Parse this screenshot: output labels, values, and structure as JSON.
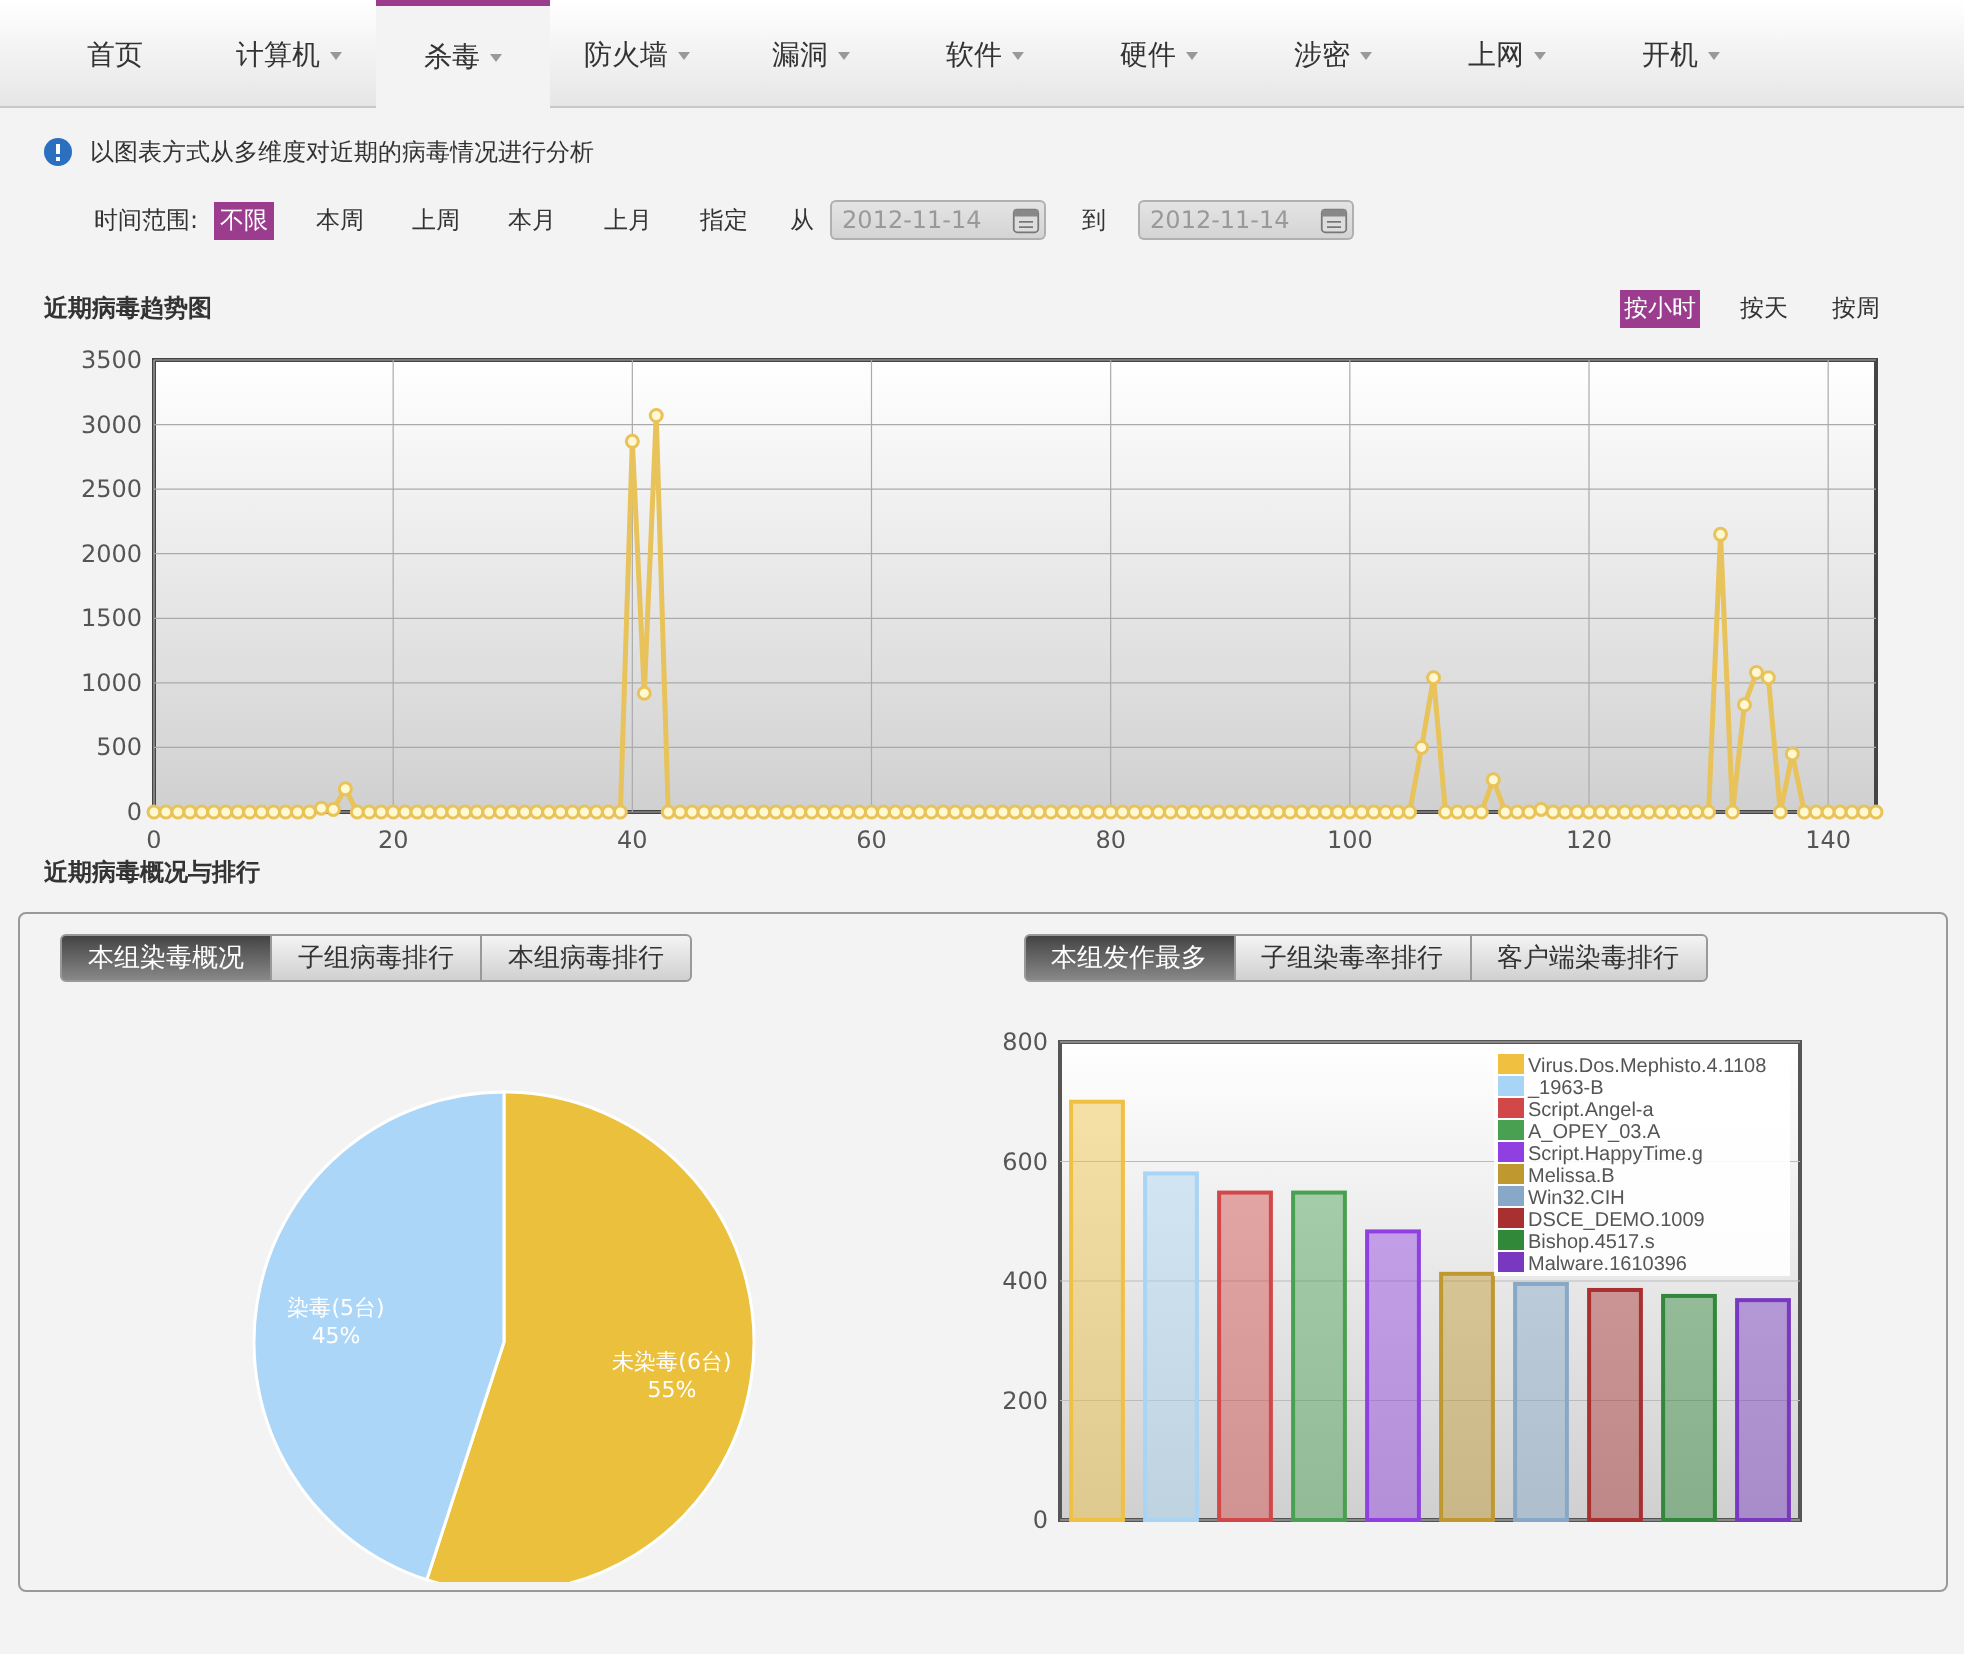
{
  "nav": {
    "tabs": [
      {
        "label": "首页",
        "has_menu": false,
        "selected": false
      },
      {
        "label": "计算机",
        "has_menu": true,
        "selected": false
      },
      {
        "label": "杀毒",
        "has_menu": true,
        "selected": true
      },
      {
        "label": "防火墙",
        "has_menu": true,
        "selected": false
      },
      {
        "label": "漏洞",
        "has_menu": true,
        "selected": false
      },
      {
        "label": "软件",
        "has_menu": true,
        "selected": false
      },
      {
        "label": "硬件",
        "has_menu": true,
        "selected": false
      },
      {
        "label": "涉密",
        "has_menu": true,
        "selected": false
      },
      {
        "label": "上网",
        "has_menu": true,
        "selected": false
      },
      {
        "label": "开机",
        "has_menu": true,
        "selected": false
      }
    ]
  },
  "info": "以图表方式从多维度对近期的病毒情况进行分析",
  "time_filter": {
    "label": "时间范围:",
    "options": [
      {
        "label": "不限",
        "selected": true
      },
      {
        "label": "本周",
        "selected": false
      },
      {
        "label": "上周",
        "selected": false
      },
      {
        "label": "本月",
        "selected": false
      },
      {
        "label": "上月",
        "selected": false
      },
      {
        "label": "指定",
        "selected": false
      }
    ],
    "from_label": "从",
    "from_value": "2012-11-14",
    "to_label": "到",
    "to_value": "2012-11-14"
  },
  "trend": {
    "title": "近期病毒趋势图",
    "modes": [
      {
        "label": "按小时",
        "selected": true
      },
      {
        "label": "按天",
        "selected": false
      },
      {
        "label": "按周",
        "selected": false
      }
    ],
    "chart_data": {
      "type": "line",
      "grid": true,
      "ylim": [
        0,
        3500
      ],
      "yticks": [
        0,
        500,
        1000,
        1500,
        2000,
        2500,
        3000,
        3500
      ],
      "xlim": [
        0,
        144
      ],
      "xticks": [
        0,
        20,
        40,
        60,
        80,
        100,
        120,
        140
      ],
      "x": [
        0,
        1,
        2,
        3,
        4,
        5,
        6,
        7,
        8,
        9,
        10,
        11,
        12,
        13,
        14,
        15,
        16,
        17,
        18,
        19,
        20,
        21,
        22,
        23,
        24,
        25,
        26,
        27,
        28,
        29,
        30,
        31,
        32,
        33,
        34,
        35,
        36,
        37,
        38,
        39,
        40,
        41,
        42,
        43,
        44,
        45,
        46,
        47,
        48,
        49,
        50,
        51,
        52,
        53,
        54,
        55,
        56,
        57,
        58,
        59,
        60,
        61,
        62,
        63,
        64,
        65,
        66,
        67,
        68,
        69,
        70,
        71,
        72,
        73,
        74,
        75,
        76,
        77,
        78,
        79,
        80,
        81,
        82,
        83,
        84,
        85,
        86,
        87,
        88,
        89,
        90,
        91,
        92,
        93,
        94,
        95,
        96,
        97,
        98,
        99,
        100,
        101,
        102,
        103,
        104,
        105,
        106,
        107,
        108,
        109,
        110,
        111,
        112,
        113,
        114,
        115,
        116,
        117,
        118,
        119,
        120,
        121,
        122,
        123,
        124,
        125,
        126,
        127,
        128,
        129,
        130,
        131,
        132,
        133,
        134,
        135,
        136,
        137,
        138,
        139,
        140,
        141,
        142,
        143,
        144
      ],
      "series": [
        {
          "color": "#e8c25a",
          "marker": "circle",
          "values": [
            0,
            0,
            0,
            0,
            0,
            0,
            0,
            0,
            0,
            0,
            0,
            0,
            0,
            0,
            30,
            20,
            180,
            0,
            0,
            0,
            0,
            0,
            0,
            0,
            0,
            0,
            0,
            0,
            0,
            0,
            0,
            0,
            0,
            0,
            0,
            0,
            0,
            0,
            0,
            0,
            2870,
            920,
            3070,
            0,
            0,
            0,
            0,
            0,
            0,
            0,
            0,
            0,
            0,
            0,
            0,
            0,
            0,
            0,
            0,
            0,
            0,
            0,
            0,
            0,
            0,
            0,
            0,
            0,
            0,
            0,
            0,
            0,
            0,
            0,
            0,
            0,
            0,
            0,
            0,
            0,
            0,
            0,
            0,
            0,
            0,
            0,
            0,
            0,
            0,
            0,
            0,
            0,
            0,
            0,
            0,
            0,
            0,
            0,
            0,
            0,
            0,
            0,
            0,
            0,
            0,
            0,
            500,
            1040,
            0,
            0,
            0,
            0,
            250,
            0,
            0,
            0,
            20,
            0,
            0,
            0,
            0,
            0,
            0,
            0,
            0,
            0,
            0,
            0,
            0,
            0,
            0,
            2150,
            0,
            830,
            1080,
            1040,
            0,
            450,
            0,
            0,
            0,
            0,
            0,
            0,
            0
          ]
        }
      ]
    }
  },
  "overview": {
    "title": "近期病毒概况与排行",
    "left": {
      "tabs": [
        {
          "label": "本组染毒概况",
          "selected": true
        },
        {
          "label": "子组病毒排行",
          "selected": false
        },
        {
          "label": "本组病毒排行",
          "selected": false
        }
      ],
      "chart_data": {
        "type": "pie",
        "categories": [
          "未染毒(6台)",
          "染毒(5台)"
        ],
        "values": [
          55,
          45
        ],
        "value_labels": [
          "55%",
          "45%"
        ]
      }
    },
    "right": {
      "tabs": [
        {
          "label": "本组发作最多",
          "selected": true
        },
        {
          "label": "子组染毒率排行",
          "selected": false
        },
        {
          "label": "客户端染毒排行",
          "selected": false
        }
      ],
      "chart_data": {
        "type": "bar",
        "grid": true,
        "legend": true,
        "ylim": [
          0,
          800
        ],
        "yticks": [
          0,
          200,
          400,
          600,
          800
        ],
        "series": [
          {
            "name": "Virus.Dos.Mephisto.4.1108",
            "color": "#f0c040",
            "values": [
              700
            ]
          },
          {
            "name": "_1963-B",
            "color": "#a8d4f5",
            "values": [
              580
            ]
          },
          {
            "name": "Script.Angel-a",
            "color": "#d24848",
            "values": [
              548
            ]
          },
          {
            "name": "A_OPEY_03.A",
            "color": "#48a050",
            "values": [
              548
            ]
          },
          {
            "name": "Script.HappyTime.g",
            "color": "#9040e0",
            "values": [
              483
            ]
          },
          {
            "name": "Melissa.B",
            "color": "#c09830",
            "values": [
              412
            ]
          },
          {
            "name": "Win32.CIH",
            "color": "#88a8c8",
            "values": [
              395
            ]
          },
          {
            "name": "DSCE_DEMO.1009",
            "color": "#a83030",
            "values": [
              385
            ]
          },
          {
            "name": "Bishop.4517.s",
            "color": "#308838",
            "values": [
              375
            ]
          },
          {
            "name": "Malware.1610396",
            "color": "#7838c0",
            "values": [
              368
            ]
          }
        ]
      }
    }
  }
}
